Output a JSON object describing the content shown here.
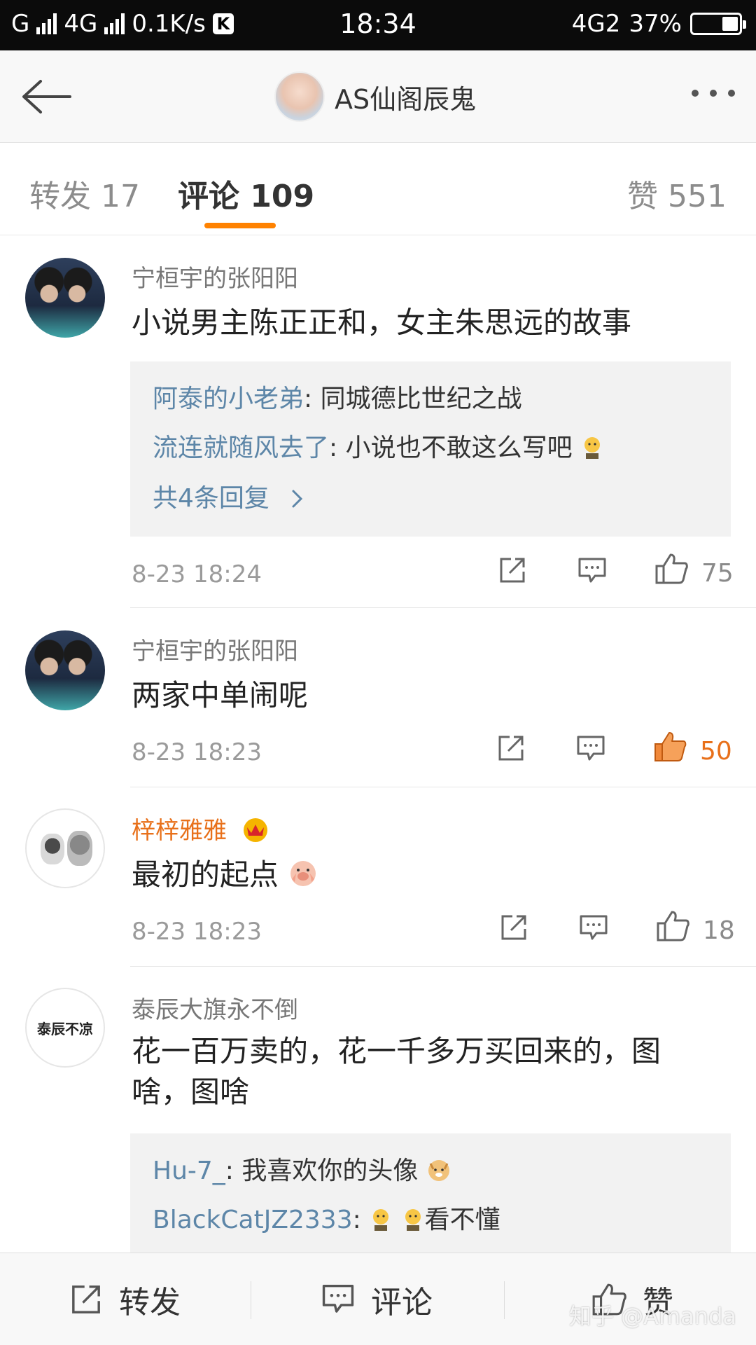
{
  "status_bar": {
    "left": "G",
    "net": "4G",
    "speed": "0.1K/s",
    "badge": "K",
    "time": "18:34",
    "net_right": "4G2",
    "battery": "37%"
  },
  "header": {
    "title": "AS仙阁辰鬼"
  },
  "tabs": {
    "repost": "转发 17",
    "comment": "评论 109",
    "like": "赞 551"
  },
  "comments": [
    {
      "user": "宁桓宇的张阳阳",
      "text": "小说男主陈正正和，女主朱思远的故事",
      "replies": [
        {
          "name": "阿泰的小老弟",
          "text": ": 同城德比世纪之战"
        },
        {
          "name": "流连就随风去了",
          "text": ": 小说也不敢这么写吧"
        }
      ],
      "more_replies": "共4条回复",
      "time": "8-23 18:24",
      "likes": "75"
    },
    {
      "user": "宁桓宇的张阳阳",
      "text": "两家中单闹呢",
      "time": "8-23 18:23",
      "likes": "50",
      "liked": true
    },
    {
      "user": "梓梓雅雅",
      "text": "最初的起点",
      "time": "8-23 18:23",
      "likes": "18"
    },
    {
      "user": "泰辰大旗永不倒",
      "avatar_text": "泰辰不凉",
      "text": "花一百万卖的，花一千多万买回来的，图啥，图啥",
      "replies": [
        {
          "name": "Hu-7_",
          "text": ": 我喜欢你的头像"
        },
        {
          "name": "BlackCatJZ2333",
          "text": ": 看不懂"
        }
      ]
    }
  ],
  "bottom_bar": {
    "repost": "转发",
    "comment": "评论",
    "like": "赞"
  },
  "watermark": "知乎 @Amanda",
  "colors": {
    "accent": "#ff8200",
    "link": "#5d86a8",
    "vip": "#e8701a"
  }
}
